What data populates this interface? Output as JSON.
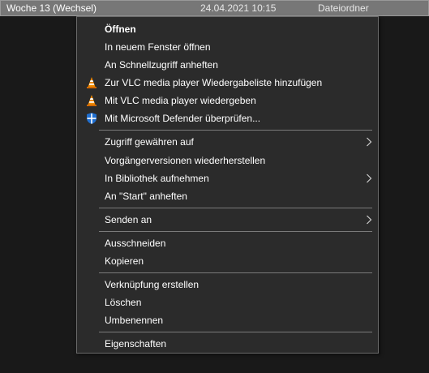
{
  "file_row": {
    "name": "Woche 13 (Wechsel)",
    "date": "24.04.2021 10:15",
    "type": "Dateiordner"
  },
  "menu": {
    "open": "Öffnen",
    "open_new_window": "In neuem Fenster öffnen",
    "pin_quick_access": "An Schnellzugriff anheften",
    "vlc_add_playlist": "Zur VLC media player Wiedergabeliste hinzufügen",
    "vlc_play": "Mit VLC media player wiedergeben",
    "defender_scan": "Mit Microsoft Defender überprüfen...",
    "give_access": "Zugriff gewähren auf",
    "restore_versions": "Vorgängerversionen wiederherstellen",
    "include_library": "In Bibliothek aufnehmen",
    "pin_start": "An \"Start\" anheften",
    "send_to": "Senden an",
    "cut": "Ausschneiden",
    "copy": "Kopieren",
    "create_shortcut": "Verknüpfung erstellen",
    "delete": "Löschen",
    "rename": "Umbenennen",
    "properties": "Eigenschaften"
  },
  "colors": {
    "menu_bg": "#2b2b2b",
    "menu_border": "#6a6a6a",
    "selection": "#777777",
    "vlc_orange": "#f08a00",
    "defender_blue": "#1f6fd1"
  }
}
